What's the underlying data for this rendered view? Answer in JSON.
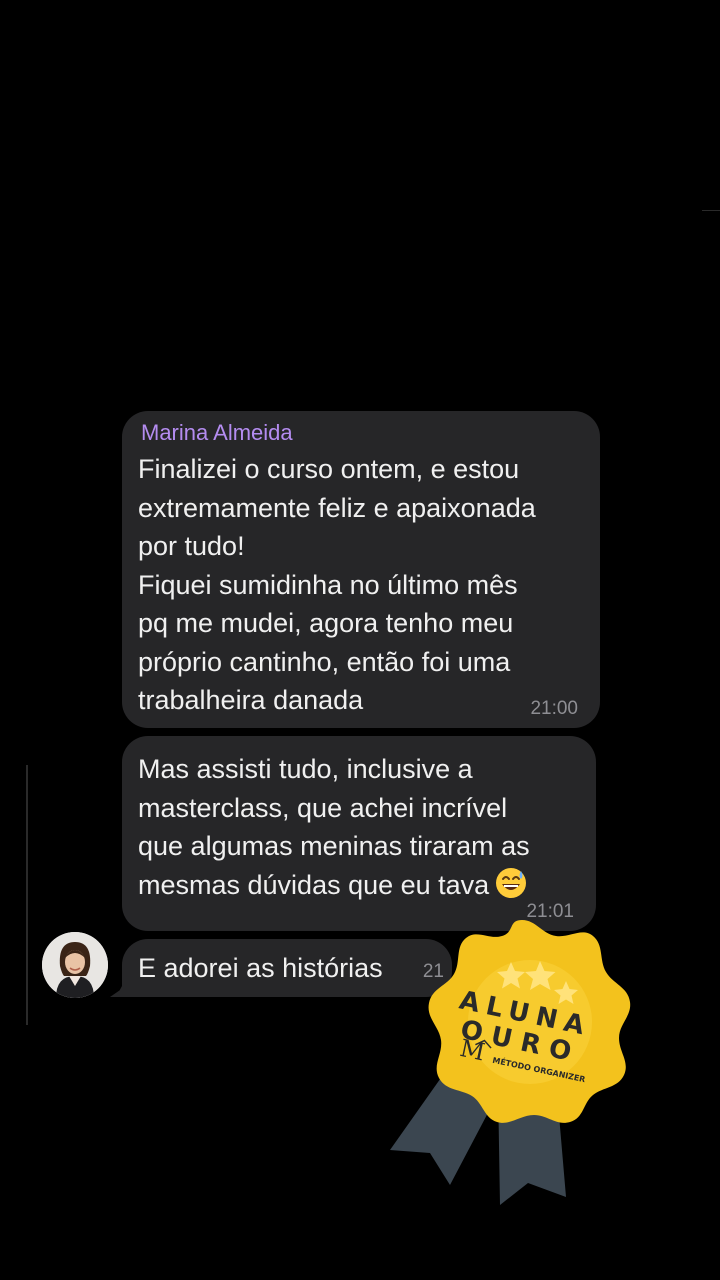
{
  "chat": {
    "sender_name": "Marina Almeida",
    "messages": [
      {
        "text": "Finalizei o curso ontem, e estou\nextremamente feliz e apaixonada\npor tudo!\nFiquei sumidinha no último mês\npq me mudei, agora tenho meu\npróprio cantinho, então foi uma\ntrabalheira danada",
        "time": "21:00"
      },
      {
        "text": "Mas assisti tudo, inclusive a\nmasterclass, que achei incrível\nque algumas meninas tiraram as\nmesmas dúvidas que eu tava",
        "emoji": "grinning-sweat-emoji",
        "time": "21:01"
      },
      {
        "text": "E adorei as histórias",
        "time": "21"
      }
    ]
  },
  "badge": {
    "line1": "ALUNA",
    "line2": "OURO",
    "brand_mark": "M",
    "brand_name": "MÉTODO ORGANIZER",
    "stars": 3,
    "colors": {
      "gold": "#f3c21d",
      "gold_dark": "#e0aa12",
      "ribbon": "#3b4650"
    }
  },
  "colors": {
    "background": "#000000",
    "bubble": "#262628",
    "sender": "#b48cf0",
    "timestamp": "#8e8e93"
  }
}
